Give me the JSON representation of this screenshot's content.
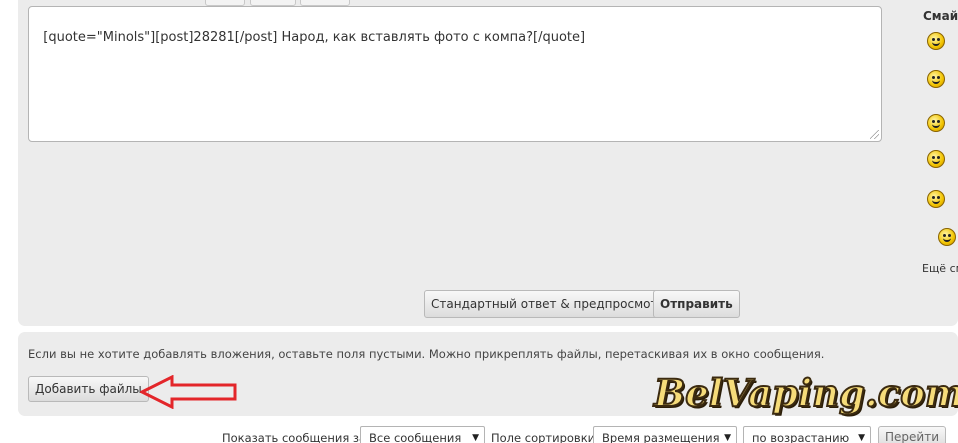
{
  "editor": {
    "content": "[quote=\"Minols\"][post]28281[/post] Народ, как вставлять фото с компа?[/quote]"
  },
  "smilies": {
    "title": "Смайл",
    "icons": [
      "grin-smiley-icon",
      "thinking-smiley-icon",
      "tongue-smiley-icon",
      "question-smiley-icon",
      "cool-sunglasses-smiley-icon",
      "hat-smiley-icon"
    ],
    "more_label": "Ещё см"
  },
  "actions": {
    "preview_label": "Стандартный ответ & предпросмотр",
    "submit_label": "Отправить"
  },
  "attachments": {
    "hint": "Если вы не хотите добавлять вложения, оставьте поля пустыми. Можно прикреплять файлы, перетаскивая их в окно сообщения.",
    "add_files_label": "Добавить файлы"
  },
  "watermark": {
    "text": "BelVaping.com",
    "color": "#f6dc7a"
  },
  "filters": {
    "show_label": "Показать сообщения за:",
    "show_value": "Все сообщения",
    "sort_label": "Поле сортировки",
    "sort_value": "Время размещения",
    "order_value": "по возрастанию",
    "go_label": "Перейти"
  },
  "colors": {
    "panel": "#ececec",
    "arrow": "#e3262a"
  }
}
